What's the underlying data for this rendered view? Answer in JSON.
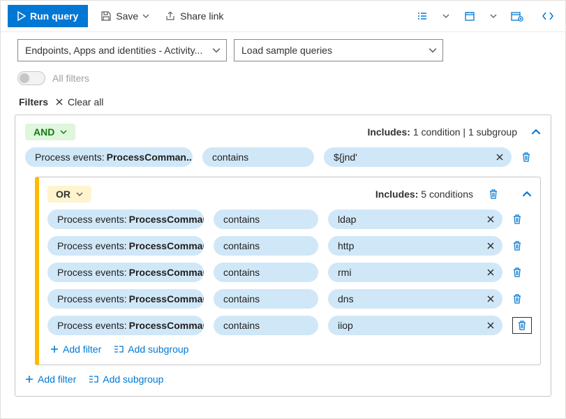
{
  "toolbar": {
    "run": "Run query",
    "save": "Save",
    "share": "Share link"
  },
  "dropdowns": {
    "scope": "Endpoints, Apps and identities - Activity...",
    "samples": "Load sample queries"
  },
  "toggle": {
    "label": "All filters"
  },
  "filtersHead": {
    "label": "Filters",
    "clear": "Clear all"
  },
  "outer": {
    "op": "AND",
    "includesLabel": "Includes:",
    "includesValue": "1 condition | 1 subgroup",
    "cond": {
      "fieldPrefix": "Process events: ",
      "fieldValue": "ProcessComman...",
      "operator": "contains",
      "value": "${jnd'"
    }
  },
  "sub": {
    "op": "OR",
    "includesLabel": "Includes:",
    "includesValue": "5 conditions",
    "rows": [
      {
        "fieldPrefix": "Process events: ",
        "fieldValue": "ProcessComman...",
        "operator": "contains",
        "value": "ldap"
      },
      {
        "fieldPrefix": "Process events: ",
        "fieldValue": "ProcessComman...",
        "operator": "contains",
        "value": "http"
      },
      {
        "fieldPrefix": "Process events: ",
        "fieldValue": "ProcessComman...",
        "operator": "contains",
        "value": "rmi"
      },
      {
        "fieldPrefix": "Process events: ",
        "fieldValue": "ProcessComman...",
        "operator": "contains",
        "value": "dns"
      },
      {
        "fieldPrefix": "Process events: ",
        "fieldValue": "ProcessComman...",
        "operator": "contains",
        "value": "iiop"
      }
    ]
  },
  "actions": {
    "addFilter": "Add filter",
    "addSubgroup": "Add subgroup"
  }
}
